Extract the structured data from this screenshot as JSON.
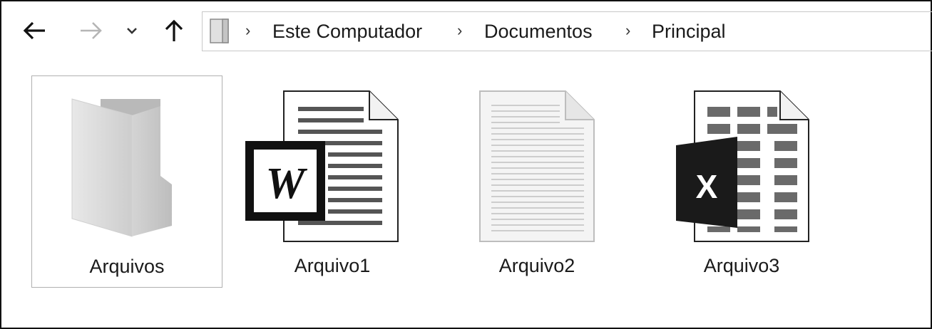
{
  "toolbar": {
    "back_icon": "arrow-left-icon",
    "forward_icon": "arrow-right-icon",
    "recent_icon": "chevron-down-icon",
    "up_icon": "arrow-up-icon"
  },
  "address_bar": {
    "location_icon": "computer-icon",
    "breadcrumbs": [
      "Este Computador",
      "Documentos",
      "Principal"
    ]
  },
  "files": [
    {
      "name": "Arquivos",
      "icon": "folder-icon",
      "selected": true
    },
    {
      "name": "Arquivo1",
      "icon": "word-document-icon",
      "selected": false
    },
    {
      "name": "Arquivo2",
      "icon": "text-document-icon",
      "selected": false
    },
    {
      "name": "Arquivo3",
      "icon": "excel-spreadsheet-icon",
      "selected": false
    }
  ],
  "colors": {
    "selection_border": "#b0b0b0",
    "text": "#1a1a1a"
  }
}
